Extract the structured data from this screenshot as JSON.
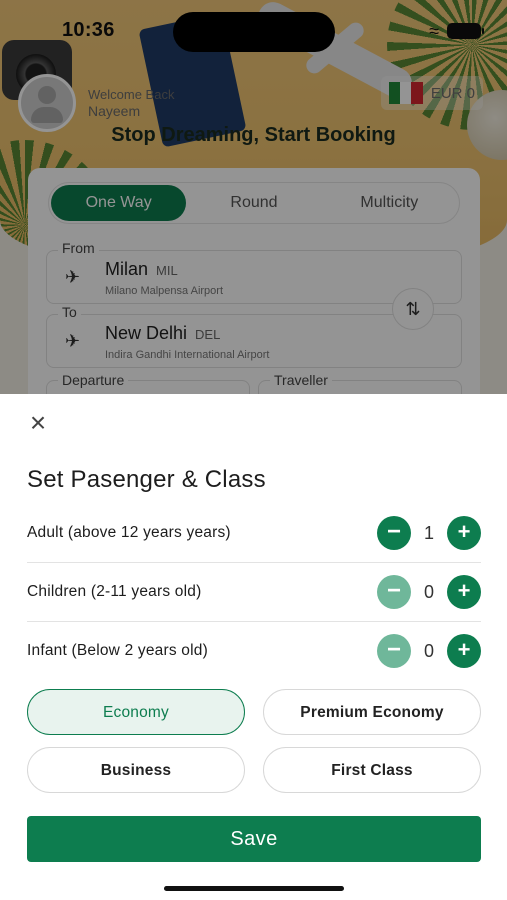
{
  "status_bar": {
    "time": "10:36"
  },
  "header": {
    "welcome_label": "Welcome Back",
    "user_name": "Nayeem",
    "currency": "EUR 0",
    "tagline": "Stop Dreaming, Start Booking"
  },
  "search": {
    "trip_types": [
      "One Way",
      "Round",
      "Multicity"
    ],
    "selected_trip_type": "One Way",
    "from_label": "From",
    "from_city": "Milan",
    "from_code": "MIL",
    "from_airport": "Milano Malpensa Airport",
    "to_label": "To",
    "to_city": "New Delhi",
    "to_code": "DEL",
    "to_airport": "Indira Gandhi International Airport",
    "departure_label": "Departure",
    "traveller_label": "Traveller"
  },
  "sheet": {
    "title": "Set Pasenger & Class",
    "passengers": [
      {
        "label": "Adult (above 12 years years)",
        "value": "1",
        "minus_enabled": true
      },
      {
        "label": "Children (2-11 years old)",
        "value": "0",
        "minus_enabled": false
      },
      {
        "label": "Infant (Below 2 years old)",
        "value": "0",
        "minus_enabled": false
      }
    ],
    "classes": [
      "Economy",
      "Premium Economy",
      "Business",
      "First Class"
    ],
    "selected_class": "Economy",
    "save_label": "Save"
  },
  "colors": {
    "primary": "#0d7d4f",
    "primary_disabled": "#6fb79a",
    "selected_class_bg": "#e8f3ee"
  }
}
